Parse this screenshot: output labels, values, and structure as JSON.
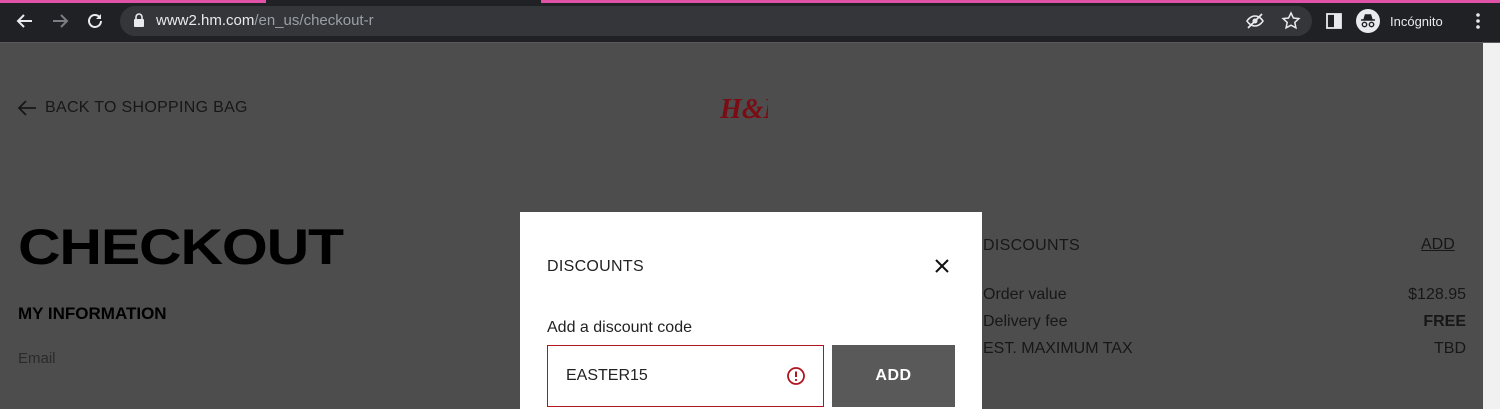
{
  "browser": {
    "url_domain": "www2.hm.com",
    "url_path": "/en_us/checkout-r",
    "profile_label": "Incógnito"
  },
  "page": {
    "back_link": "BACK TO SHOPPING BAG",
    "logo_text": "H&M",
    "title": "CHECKOUT",
    "section_heading": "MY INFORMATION",
    "email_label": "Email"
  },
  "summary": {
    "discounts_label": "DISCOUNTS",
    "add_label": "ADD",
    "rows": [
      {
        "label": "Order value",
        "value": "$128.95"
      },
      {
        "label": "Delivery fee",
        "value": "FREE"
      },
      {
        "label": "EST. MAXIMUM TAX",
        "value": "TBD"
      }
    ]
  },
  "modal": {
    "title": "DISCOUNTS",
    "field_label": "Add a discount code",
    "code_value": "EASTER15",
    "add_button": "ADD"
  },
  "colors": {
    "accent_tab": "#e052a8",
    "error": "#b0151e",
    "brand_red": "#c8102e"
  }
}
